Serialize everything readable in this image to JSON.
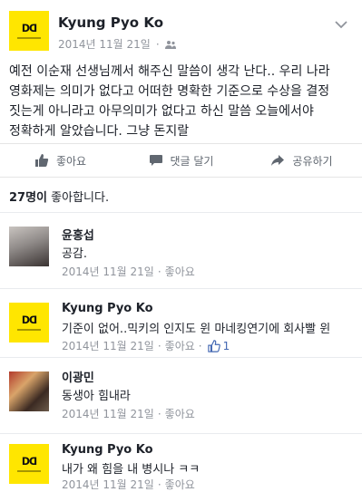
{
  "post": {
    "author": "Kyung Pyo Ko",
    "date": "2014년 11월 21일",
    "meta_sep": "·",
    "body": "예전 이순재 선생님께서 해주신 말씀이 생각 난다.. 우리 나라 영화제는 의미가 없다고 어떠한 명확한 기준으로 수상을 결정 짓는게 아니라고 아무의미가 없다고 하신 말씀 오늘에서야 정확하게 알았습니다. 그냥 돈지랄",
    "avatar_text": "ᗞᗡ"
  },
  "actions": {
    "like": "좋아요",
    "comment": "댓글 달기",
    "share": "공유하기"
  },
  "likes_summary": {
    "count": "27명이",
    "text": " 좋아합니다."
  },
  "comments": [
    {
      "author": "윤홍섭",
      "text": "공감.",
      "date": "2014년 11월 21일",
      "sep": "·",
      "like": "좋아요",
      "likes": ""
    },
    {
      "author": "Kyung Pyo Ko",
      "text": "기준이 없어..믹키의 인지도 윈 마네킹연기에 회사빨 윈",
      "date": "2014년 11월 21일",
      "sep": "·",
      "like": "좋아요",
      "likes": "1"
    },
    {
      "author": "이광민",
      "text": "동생아 힘내라",
      "date": "2014년 11월 21일",
      "sep": "·",
      "like": "좋아요",
      "likes": ""
    },
    {
      "author": "Kyung Pyo Ko",
      "text": "내가 왜 힘을 내 병시나 ㅋㅋ",
      "date": "2014년 11월 21일",
      "sep": "·",
      "like": "좋아요",
      "likes": ""
    }
  ],
  "colors": {
    "brand_yellow": "#ffe600",
    "meta_grey": "#90949c",
    "link_blue": "#4267b2"
  },
  "icons": [
    "friends-icon",
    "chevron-down-icon",
    "thumbs-up-icon",
    "comment-icon",
    "share-icon"
  ]
}
